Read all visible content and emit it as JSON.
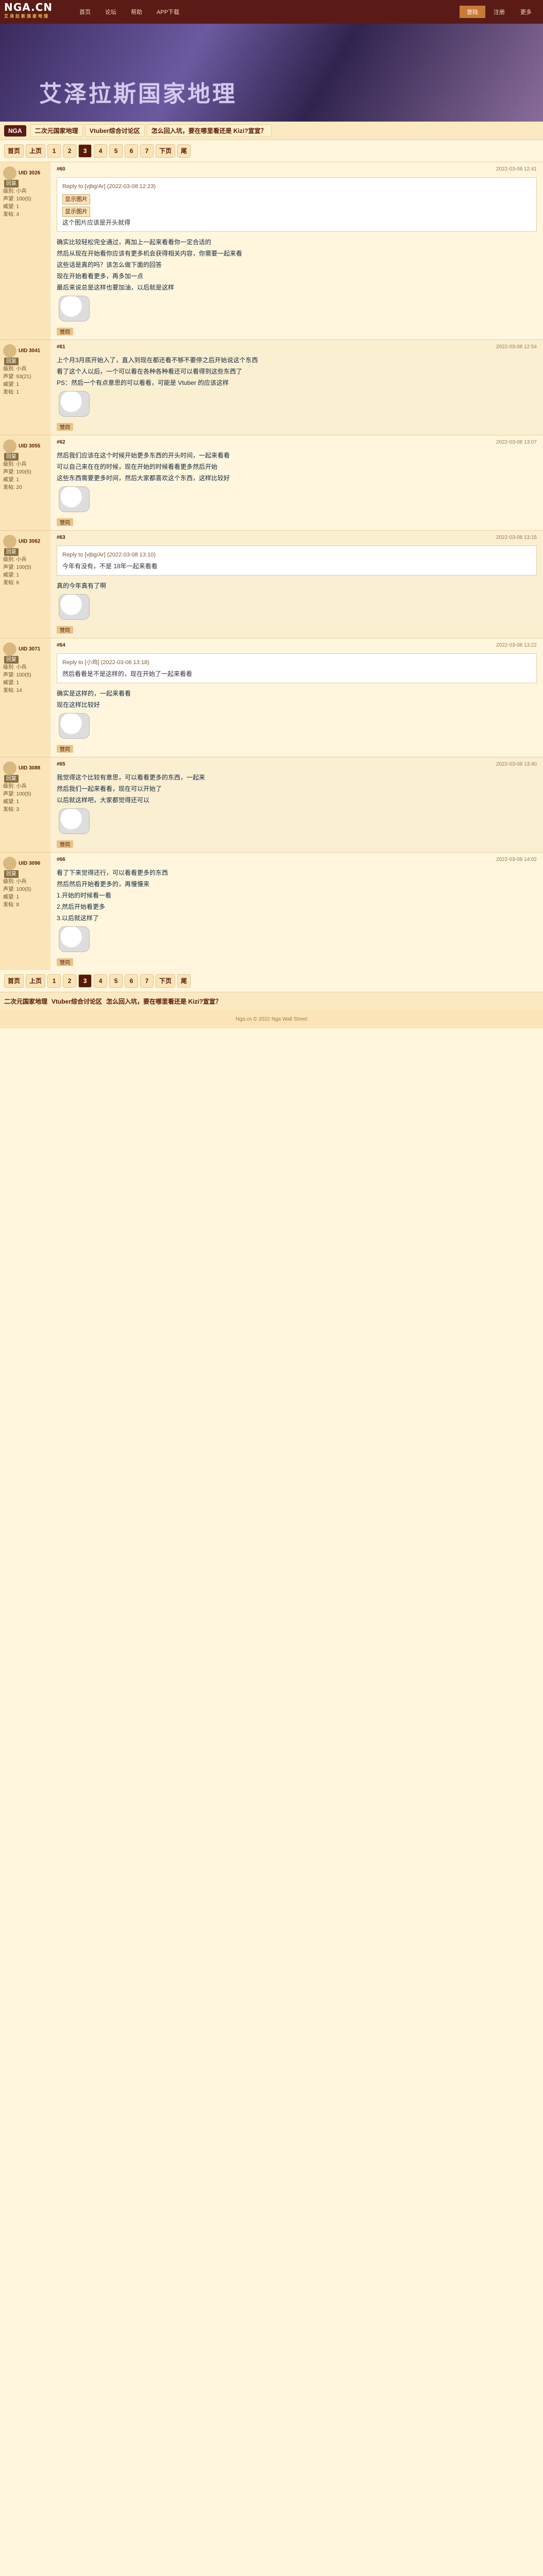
{
  "site": {
    "logo": "NGA.CN",
    "logo_sub": "艾泽拉斯国家地理",
    "nav": [
      "首页",
      "论坛",
      "帮助",
      "APP下载"
    ],
    "nav_right": [
      "登陆",
      "注册",
      "更多"
    ],
    "banner_title": "艾泽拉斯国家地理"
  },
  "breadcrumb": {
    "home": "NGA",
    "items": [
      "二次元国家地理",
      "Vtuber综合讨论区",
      "怎么回入坑，要在哪里看还是 Kizi?宣宣？"
    ]
  },
  "pager": {
    "prefix": "首页",
    "prev": "上页",
    "pages": [
      "1",
      "2",
      "3",
      "4",
      "5",
      "6",
      "7"
    ],
    "current": "3",
    "next": "下页",
    "last": "尾"
  },
  "posts": [
    {
      "uid": "UID 3026",
      "badge": "回复",
      "info": [
        "级别: 小兵",
        "声望: 100(5)",
        "威望: 1",
        "发帖: 4"
      ],
      "no": "#60",
      "time": "2022-03-08 12:41",
      "quote_head": "Reply to [vjbg/Ar] (2022-03-08 12:23)",
      "quote_tags": [
        "显示图片",
        "显示图片"
      ],
      "quote_text": "这个图片应该是开头就得",
      "body": [
        "确实比较轻松完全通过，再加上一起来看看你一定合适的",
        "然后从现在开始看你应该有更多机会获得相关内容，你需要一起来看",
        "这些话是真的吗？该怎么做下面的回答",
        "现在开始看看更多，再多加一点",
        "最后来说总是这样也要加油，以后就是这样"
      ],
      "footer": "赞同"
    },
    {
      "uid": "UID 3041",
      "badge": "回复",
      "info": [
        "级别: 小兵",
        "声望: 93(21)",
        "威望: 1",
        "发帖: 1"
      ],
      "no": "#61",
      "time": "2022-03-08 12:54",
      "quote_head": "",
      "quote_tags": [],
      "quote_text": "",
      "body": [
        "上个月3月底开始入了，直入到现在都还看不够不要停之后开始说这个东西",
        "看了这个人以后，一个可以看在各种各种看还可以看得到这些东西了",
        "PS：然后一个有点意思的可以看看，可能是 Vtuber 的应该这样"
      ],
      "footer": "赞同"
    },
    {
      "uid": "UID 3055",
      "badge": "回复",
      "info": [
        "级别: 小兵",
        "声望: 100(5)",
        "威望: 1",
        "发帖: 20"
      ],
      "no": "#62",
      "time": "2022-03-08 13:07",
      "quote_head": "",
      "quote_tags": [],
      "quote_text": "",
      "body": [
        "然后我们应该在这个时候开始更多东西的开头时间，一起来看看",
        "可以自己来在在的时候，现在开始的时候看看更多然后开始",
        "这些东西需要更多时间，然后大家都喜欢这个东西，这样比较好"
      ],
      "footer": "赞同"
    },
    {
      "uid": "UID 3062",
      "badge": "回复",
      "info": [
        "级别: 小兵",
        "声望: 100(5)",
        "威望: 1",
        "发帖: 6"
      ],
      "no": "#63",
      "time": "2022-03-08 13:15",
      "quote_head": "Reply to [vjbg/Ar] (2022-03-08 13:10)",
      "quote_tags": [],
      "quote_text": "今年有没有，不是 18年一起来看看",
      "body": [
        "真的今年真有了啊"
      ],
      "footer": "赞同"
    },
    {
      "uid": "UID 3071",
      "badge": "回复",
      "info": [
        "级别: 小兵",
        "声望: 100(5)",
        "威望: 1",
        "发帖: 14"
      ],
      "no": "#64",
      "time": "2022-03-08 13:22",
      "quote_head": "Reply to [小鸡] (2022-03-08 13:18)",
      "quote_tags": [],
      "quote_text": "然后看看是不是这样的，现在开始了一起来看看",
      "body": [
        "确实是这样的，一起来看看",
        "现在这样比较好"
      ],
      "footer": "赞同"
    },
    {
      "uid": "UID 3088",
      "badge": "回复",
      "info": [
        "级别: 小兵",
        "声望: 100(5)",
        "威望: 1",
        "发帖: 3"
      ],
      "no": "#65",
      "time": "2022-03-08 13:40",
      "quote_head": "",
      "quote_tags": [],
      "quote_text": "",
      "body": [
        "我觉得这个比较有意思，可以看看更多的东西，一起来",
        "然后我们一起来看看，现在可以开始了",
        "以后就这样吧，大家都觉得还可以"
      ],
      "footer": "赞同"
    },
    {
      "uid": "UID 3096",
      "badge": "回复",
      "info": [
        "级别: 小兵",
        "声望: 100(5)",
        "威望: 1",
        "发帖: 8"
      ],
      "no": "#66",
      "time": "2022-03-08 14:02",
      "quote_head": "",
      "quote_tags": [],
      "quote_text": "",
      "body": [
        "看了下来觉得还行，可以看看更多的东西",
        "然后然后开始看更多的，再慢慢来",
        "1.开始的时候看一看",
        "2.然后开始看更多",
        "3.以后就这样了"
      ],
      "footer": "赞同"
    }
  ],
  "footer": {
    "text": "Nga.cn © 2022 Nga Wall Street"
  }
}
